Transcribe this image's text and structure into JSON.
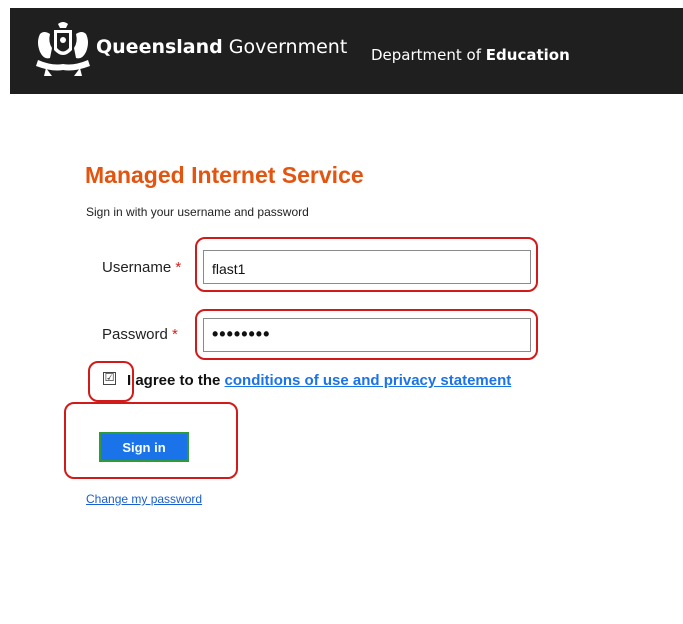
{
  "header": {
    "brand_bold": "Queensland",
    "brand_light": "Government",
    "dept_prefix": "Department of",
    "dept_bold": "Education",
    "crest_icon": "queensland-coat-of-arms-icon"
  },
  "main": {
    "title": "Managed Internet Service",
    "subtitle": "Sign in with your username and password",
    "username_label": "Username",
    "username_value": "flast1",
    "password_label": "Password",
    "password_value": "••••••••",
    "required_marker": "*",
    "checkbox_mark": "☑",
    "agree_prefix": "I agree to the",
    "agree_link": "conditions of use and privacy statement",
    "signin_label": "Sign in",
    "change_password": "Change my password"
  },
  "colors": {
    "title": "#e3540f",
    "highlight": "#d11a1a",
    "button": "#1a73e8",
    "header_bg": "#1f1f1f"
  }
}
